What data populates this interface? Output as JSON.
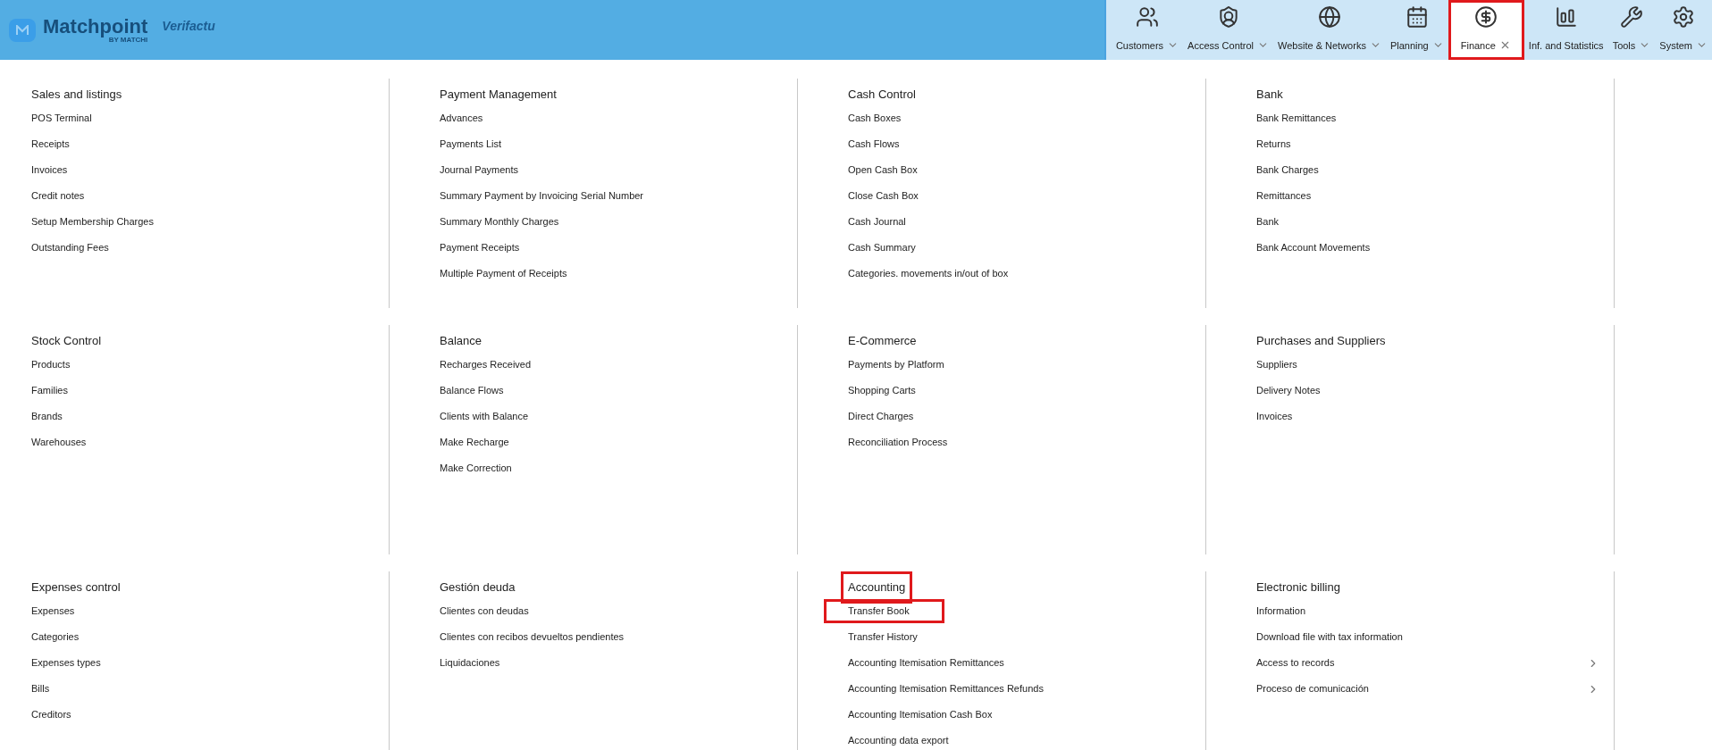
{
  "logo": {
    "name": "Matchpoint",
    "byline": "BY MATCHI",
    "partner": "Verifactu"
  },
  "nav": [
    {
      "label": "Customers",
      "dropdown": true,
      "selected": false,
      "highlighted": false
    },
    {
      "label": "Access Control",
      "dropdown": true,
      "selected": false,
      "highlighted": false
    },
    {
      "label": "Website & Networks",
      "dropdown": true,
      "selected": false,
      "highlighted": false
    },
    {
      "label": "Planning",
      "dropdown": true,
      "selected": false,
      "highlighted": false
    },
    {
      "label": "Finance",
      "selected": true,
      "highlighted": true
    },
    {
      "label": "Inf. and Statistics",
      "dropdown": false,
      "selected": false,
      "highlighted": false
    },
    {
      "label": "Tools",
      "dropdown": true,
      "selected": false,
      "highlighted": false
    },
    {
      "label": "System",
      "dropdown": true,
      "selected": false,
      "highlighted": false
    }
  ],
  "sections": [
    {
      "title": "Sales and listings",
      "highlighted": false,
      "items": [
        {
          "label": "POS Terminal"
        },
        {
          "label": "Receipts"
        },
        {
          "label": "Invoices"
        },
        {
          "label": "Credit notes"
        },
        {
          "label": "Setup Membership Charges"
        },
        {
          "label": "Outstanding Fees"
        }
      ]
    },
    {
      "title": "Payment Management",
      "highlighted": false,
      "items": [
        {
          "label": "Advances"
        },
        {
          "label": "Payments List"
        },
        {
          "label": "Journal Payments"
        },
        {
          "label": "Summary Payment by Invoicing Serial Number"
        },
        {
          "label": "Summary Monthly Charges"
        },
        {
          "label": "Payment Receipts"
        },
        {
          "label": "Multiple Payment of Receipts"
        }
      ]
    },
    {
      "title": "Cash Control",
      "highlighted": false,
      "items": [
        {
          "label": "Cash Boxes"
        },
        {
          "label": "Cash Flows"
        },
        {
          "label": "Open Cash Box"
        },
        {
          "label": "Close Cash Box"
        },
        {
          "label": "Cash Journal"
        },
        {
          "label": "Cash Summary"
        },
        {
          "label": "Categories. movements in/out of box"
        }
      ]
    },
    {
      "title": "Bank",
      "highlighted": false,
      "items": [
        {
          "label": "Bank Remittances"
        },
        {
          "label": "Returns"
        },
        {
          "label": "Bank Charges"
        },
        {
          "label": "Remittances"
        },
        {
          "label": "Bank"
        },
        {
          "label": "Bank Account Movements"
        }
      ]
    },
    {
      "title": "Stock Control",
      "highlighted": false,
      "items": [
        {
          "label": "Products"
        },
        {
          "label": "Families"
        },
        {
          "label": "Brands"
        },
        {
          "label": "Warehouses"
        }
      ]
    },
    {
      "title": "Balance",
      "highlighted": false,
      "items": [
        {
          "label": "Recharges Received"
        },
        {
          "label": "Balance Flows"
        },
        {
          "label": "Clients with Balance"
        },
        {
          "label": "Make Recharge"
        },
        {
          "label": "Make Correction"
        }
      ]
    },
    {
      "title": "E-Commerce",
      "highlighted": false,
      "items": [
        {
          "label": "Payments by Platform"
        },
        {
          "label": "Shopping Carts"
        },
        {
          "label": "Direct Charges"
        },
        {
          "label": "Reconciliation Process"
        }
      ]
    },
    {
      "title": "Purchases and Suppliers",
      "highlighted": false,
      "items": [
        {
          "label": "Suppliers"
        },
        {
          "label": "Delivery Notes"
        },
        {
          "label": "Invoices"
        }
      ]
    },
    {
      "title": "Expenses control",
      "highlighted": false,
      "items": [
        {
          "label": "Expenses"
        },
        {
          "label": "Categories"
        },
        {
          "label": "Expenses types"
        },
        {
          "label": "Bills"
        },
        {
          "label": "Creditors"
        }
      ]
    },
    {
      "title": "Gestión deuda",
      "highlighted": false,
      "items": [
        {
          "label": "Clientes con deudas"
        },
        {
          "label": "Clientes con recibos devueltos pendientes"
        },
        {
          "label": "Liquidaciones"
        }
      ]
    },
    {
      "title": "Accounting",
      "highlighted": true,
      "items": [
        {
          "label": "Transfer Book",
          "highlighted": true
        },
        {
          "label": "Transfer History",
          "highlighted": false
        },
        {
          "label": "Accounting Itemisation Remittances",
          "highlighted": false
        },
        {
          "label": "Accounting Itemisation Remittances Refunds",
          "highlighted": false
        },
        {
          "label": "Accounting Itemisation Cash Box",
          "highlighted": false
        },
        {
          "label": "Accounting data export",
          "highlighted": false
        }
      ]
    },
    {
      "title": "Electronic billing",
      "highlighted": false,
      "items": [
        {
          "label": "Information",
          "submenu": false
        },
        {
          "label": "Download file with tax information",
          "submenu": false
        },
        {
          "label": "Access to records",
          "submenu": true
        },
        {
          "label": "Proceso de comunicación",
          "submenu": true
        }
      ]
    }
  ]
}
